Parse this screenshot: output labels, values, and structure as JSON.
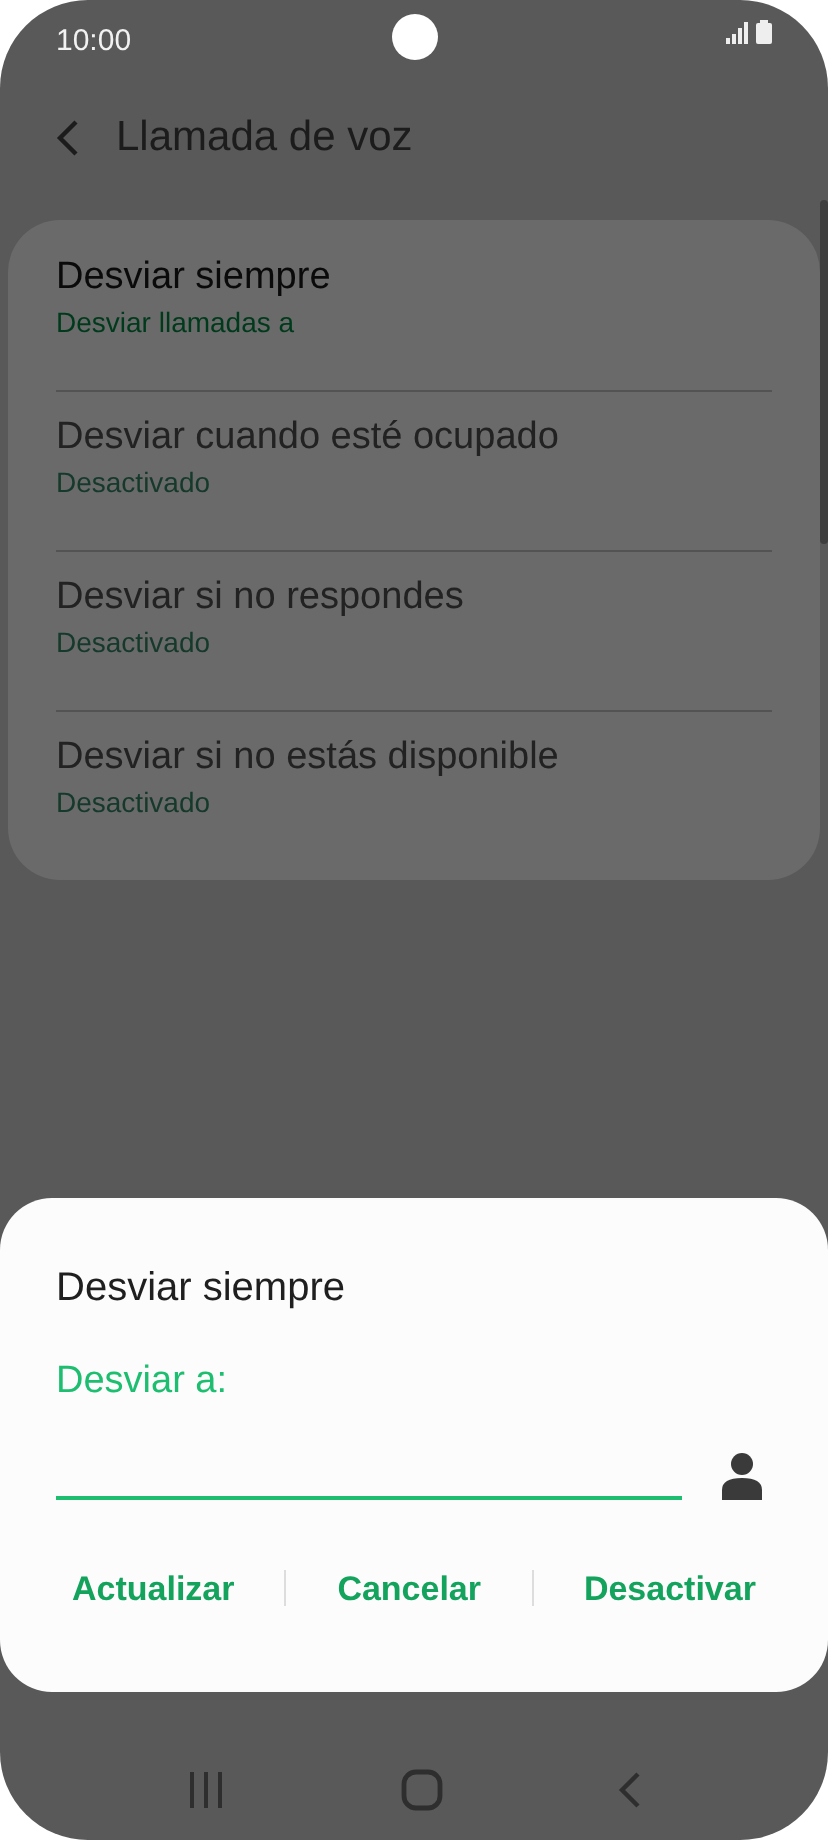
{
  "status_bar": {
    "time": "10:00"
  },
  "header": {
    "title": "Llamada de voz"
  },
  "settings": [
    {
      "title": "Desviar siempre",
      "subtitle": "Desviar llamadas a",
      "disabled": false
    },
    {
      "title": "Desviar cuando esté ocupado",
      "subtitle": "Desactivado",
      "disabled": true
    },
    {
      "title": "Desviar si no respondes",
      "subtitle": "Desactivado",
      "disabled": true
    },
    {
      "title": "Desviar si no estás disponible",
      "subtitle": "Desactivado",
      "disabled": true
    }
  ],
  "dialog": {
    "title": "Desviar siempre",
    "field_label": "Desviar a:",
    "buttons": [
      "Actualizar",
      "Cancelar",
      "Desactivar"
    ]
  }
}
